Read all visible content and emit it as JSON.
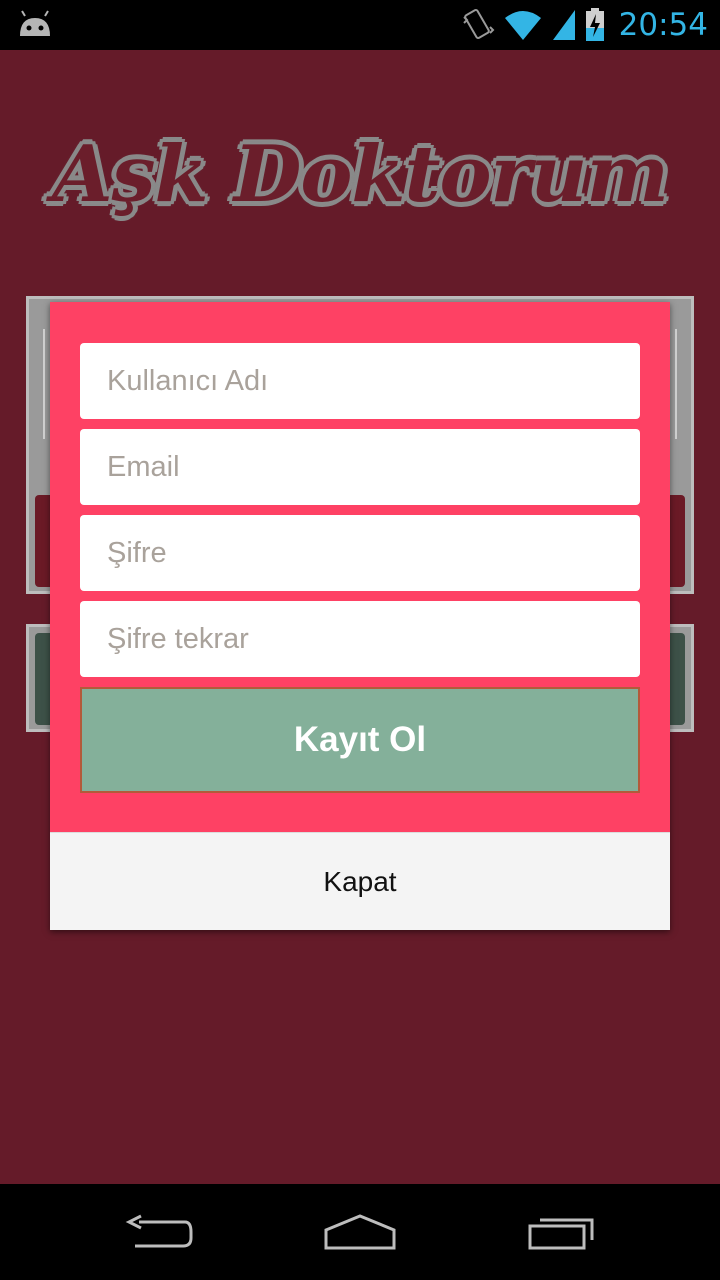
{
  "status_bar": {
    "time": "20:54",
    "icons": [
      "android-icon",
      "vibrate-icon",
      "wifi-icon",
      "signal-icon",
      "battery-charging-icon"
    ]
  },
  "app": {
    "logo_text": "Aşk Doktorum"
  },
  "register_dialog": {
    "username_placeholder": "Kullanıcı Adı",
    "email_placeholder": "Email",
    "password_placeholder": "Şifre",
    "password_repeat_placeholder": "Şifre tekrar",
    "register_label": "Kayıt Ol",
    "close_label": "Kapat"
  },
  "colors": {
    "app_background": "#651b29",
    "dialog_background": "#fe4164",
    "register_button": "#84b09a",
    "status_clock": "#33b5e5"
  },
  "nav_bar": {
    "icons": [
      "back-icon",
      "home-icon",
      "recent-apps-icon"
    ]
  }
}
